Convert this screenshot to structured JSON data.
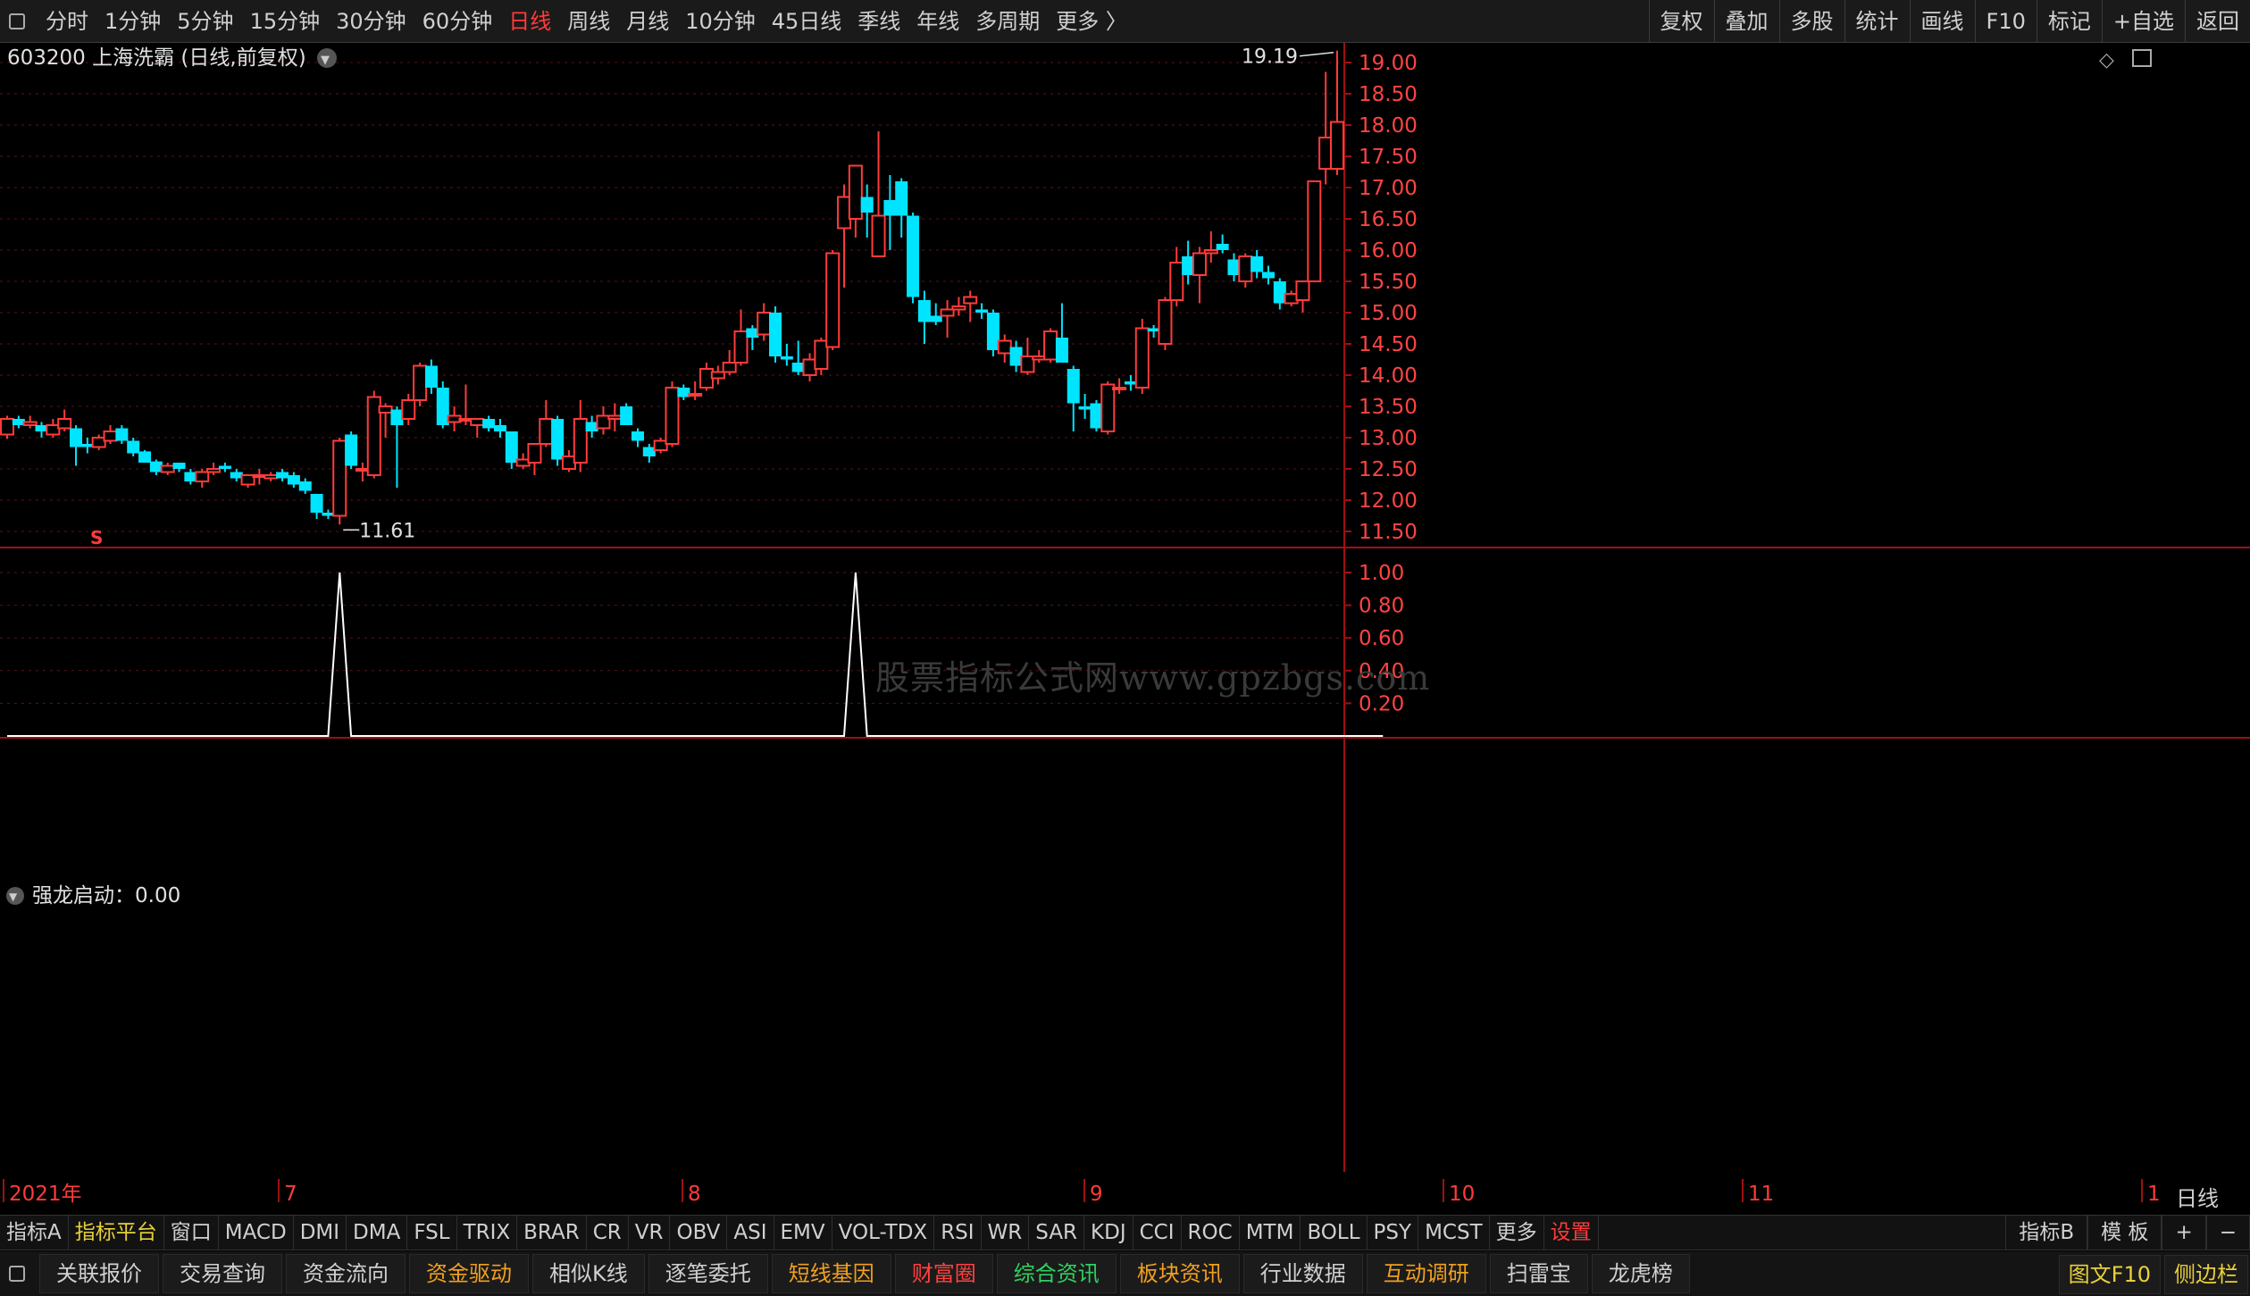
{
  "top_toolbar": {
    "left_items": [
      "分时",
      "1分钟",
      "5分钟",
      "15分钟",
      "30分钟",
      "60分钟",
      "日线",
      "周线",
      "月线",
      "10分钟",
      "45日线",
      "季线",
      "年线",
      "多周期",
      "更多 〉"
    ],
    "active": "日线",
    "right_items": [
      "复权",
      "叠加",
      "多股",
      "统计",
      "画线",
      "F10",
      "标记",
      "+自选",
      "返回"
    ]
  },
  "chart_header": {
    "code": "603200",
    "name": "上海洗霸",
    "period": "(日线,前复权)"
  },
  "watermark": "股票指标公式网www.gpzbgs.com",
  "indicator_label": "强龙启动：0.00",
  "chart_data": [
    {
      "type": "candlestick",
      "title": "603200 上海洗霸 (日线,前复权)",
      "ylim": [
        11.25,
        19.4
      ],
      "y_ticks": [
        "19.00",
        "18.50",
        "18.00",
        "17.50",
        "17.00",
        "16.50",
        "16.00",
        "15.50",
        "15.00",
        "14.50",
        "14.00",
        "13.50",
        "13.00",
        "12.50",
        "12.00",
        "11.50"
      ],
      "x_labels": [
        "2021年",
        "7",
        "8",
        "9",
        "10",
        "11",
        "1"
      ],
      "max_label": "19.19",
      "min_label": "11.61",
      "marker": "S",
      "candles": [
        {
          "o": 13.05,
          "h": 13.35,
          "l": 12.98,
          "c": 13.3
        },
        {
          "o": 13.3,
          "h": 13.35,
          "l": 13.15,
          "c": 13.2
        },
        {
          "o": 13.2,
          "h": 13.35,
          "l": 13.15,
          "c": 13.25
        },
        {
          "o": 13.2,
          "h": 13.25,
          "l": 13.0,
          "c": 13.1
        },
        {
          "o": 13.05,
          "h": 13.3,
          "l": 13.0,
          "c": 13.2
        },
        {
          "o": 13.15,
          "h": 13.45,
          "l": 13.1,
          "c": 13.3
        },
        {
          "o": 13.15,
          "h": 13.2,
          "l": 12.55,
          "c": 12.85
        },
        {
          "o": 12.9,
          "h": 13.0,
          "l": 12.75,
          "c": 12.85
        },
        {
          "o": 12.85,
          "h": 13.05,
          "l": 12.8,
          "c": 13.0
        },
        {
          "o": 12.95,
          "h": 13.2,
          "l": 12.9,
          "c": 13.1
        },
        {
          "o": 13.15,
          "h": 13.2,
          "l": 12.9,
          "c": 12.95
        },
        {
          "o": 12.95,
          "h": 13.0,
          "l": 12.7,
          "c": 12.75
        },
        {
          "o": 12.78,
          "h": 12.8,
          "l": 12.6,
          "c": 12.6
        },
        {
          "o": 12.62,
          "h": 12.65,
          "l": 12.4,
          "c": 12.45
        },
        {
          "o": 12.45,
          "h": 12.6,
          "l": 12.4,
          "c": 12.55
        },
        {
          "o": 12.6,
          "h": 12.6,
          "l": 12.45,
          "c": 12.5
        },
        {
          "o": 12.45,
          "h": 12.5,
          "l": 12.25,
          "c": 12.3
        },
        {
          "o": 12.3,
          "h": 12.5,
          "l": 12.2,
          "c": 12.45
        },
        {
          "o": 12.45,
          "h": 12.6,
          "l": 12.4,
          "c": 12.5
        },
        {
          "o": 12.55,
          "h": 12.6,
          "l": 12.45,
          "c": 12.5
        },
        {
          "o": 12.45,
          "h": 12.5,
          "l": 12.3,
          "c": 12.35
        },
        {
          "o": 12.25,
          "h": 12.4,
          "l": 12.2,
          "c": 12.4
        },
        {
          "o": 12.38,
          "h": 12.5,
          "l": 12.25,
          "c": 12.4
        },
        {
          "o": 12.35,
          "h": 12.45,
          "l": 12.3,
          "c": 12.4
        },
        {
          "o": 12.45,
          "h": 12.5,
          "l": 12.3,
          "c": 12.35
        },
        {
          "o": 12.4,
          "h": 12.45,
          "l": 12.2,
          "c": 12.25
        },
        {
          "o": 12.3,
          "h": 12.35,
          "l": 12.1,
          "c": 12.15
        },
        {
          "o": 12.1,
          "h": 12.1,
          "l": 11.7,
          "c": 11.8
        },
        {
          "o": 11.8,
          "h": 11.85,
          "l": 11.7,
          "c": 11.75
        },
        {
          "o": 11.75,
          "h": 13.0,
          "l": 11.61,
          "c": 12.95
        },
        {
          "o": 13.05,
          "h": 13.1,
          "l": 12.5,
          "c": 12.55
        },
        {
          "o": 12.5,
          "h": 12.6,
          "l": 12.3,
          "c": 12.5
        },
        {
          "o": 12.4,
          "h": 13.75,
          "l": 12.35,
          "c": 13.65
        },
        {
          "o": 13.4,
          "h": 13.55,
          "l": 13.0,
          "c": 13.5
        },
        {
          "o": 13.45,
          "h": 13.5,
          "l": 12.2,
          "c": 13.2
        },
        {
          "o": 13.3,
          "h": 13.7,
          "l": 13.2,
          "c": 13.6
        },
        {
          "o": 13.6,
          "h": 14.2,
          "l": 13.5,
          "c": 14.15
        },
        {
          "o": 14.15,
          "h": 14.25,
          "l": 13.7,
          "c": 13.8
        },
        {
          "o": 13.8,
          "h": 13.9,
          "l": 13.15,
          "c": 13.2
        },
        {
          "o": 13.25,
          "h": 13.5,
          "l": 13.1,
          "c": 13.35
        },
        {
          "o": 13.3,
          "h": 13.85,
          "l": 13.2,
          "c": 13.3
        },
        {
          "o": 13.2,
          "h": 13.3,
          "l": 13.0,
          "c": 13.3
        },
        {
          "o": 13.3,
          "h": 13.35,
          "l": 13.1,
          "c": 13.15
        },
        {
          "o": 13.2,
          "h": 13.3,
          "l": 13.0,
          "c": 13.1
        },
        {
          "o": 13.1,
          "h": 13.1,
          "l": 12.5,
          "c": 12.6
        },
        {
          "o": 12.55,
          "h": 12.75,
          "l": 12.5,
          "c": 12.65
        },
        {
          "o": 12.6,
          "h": 12.9,
          "l": 12.4,
          "c": 12.9
        },
        {
          "o": 12.9,
          "h": 13.6,
          "l": 12.85,
          "c": 13.3
        },
        {
          "o": 13.3,
          "h": 13.35,
          "l": 12.55,
          "c": 12.65
        },
        {
          "o": 12.5,
          "h": 12.8,
          "l": 12.45,
          "c": 12.7
        },
        {
          "o": 12.6,
          "h": 13.6,
          "l": 12.45,
          "c": 13.3
        },
        {
          "o": 13.25,
          "h": 13.35,
          "l": 13.0,
          "c": 13.1
        },
        {
          "o": 13.15,
          "h": 13.5,
          "l": 13.05,
          "c": 13.35
        },
        {
          "o": 13.3,
          "h": 13.55,
          "l": 13.1,
          "c": 13.35
        },
        {
          "o": 13.5,
          "h": 13.55,
          "l": 13.2,
          "c": 13.2
        },
        {
          "o": 13.1,
          "h": 13.15,
          "l": 12.85,
          "c": 12.95
        },
        {
          "o": 12.85,
          "h": 12.9,
          "l": 12.6,
          "c": 12.7
        },
        {
          "o": 12.8,
          "h": 13.0,
          "l": 12.75,
          "c": 12.95
        },
        {
          "o": 12.9,
          "h": 13.9,
          "l": 12.85,
          "c": 13.8
        },
        {
          "o": 13.8,
          "h": 13.85,
          "l": 13.6,
          "c": 13.65
        },
        {
          "o": 13.7,
          "h": 13.9,
          "l": 13.6,
          "c": 13.7
        },
        {
          "o": 13.8,
          "h": 14.2,
          "l": 13.75,
          "c": 14.1
        },
        {
          "o": 13.95,
          "h": 14.15,
          "l": 13.85,
          "c": 14.05
        },
        {
          "o": 14.05,
          "h": 14.4,
          "l": 14.0,
          "c": 14.2
        },
        {
          "o": 14.2,
          "h": 15.05,
          "l": 14.15,
          "c": 14.7
        },
        {
          "o": 14.75,
          "h": 14.8,
          "l": 14.4,
          "c": 14.6
        },
        {
          "o": 14.65,
          "h": 15.15,
          "l": 14.55,
          "c": 15.0
        },
        {
          "o": 15.0,
          "h": 15.1,
          "l": 14.2,
          "c": 14.3
        },
        {
          "o": 14.3,
          "h": 14.5,
          "l": 14.15,
          "c": 14.25
        },
        {
          "o": 14.2,
          "h": 14.55,
          "l": 14.0,
          "c": 14.05
        },
        {
          "o": 14.0,
          "h": 14.35,
          "l": 13.9,
          "c": 14.25
        },
        {
          "o": 14.1,
          "h": 14.6,
          "l": 14.0,
          "c": 14.55
        },
        {
          "o": 14.45,
          "h": 16.0,
          "l": 14.4,
          "c": 15.95
        },
        {
          "o": 16.35,
          "h": 17.05,
          "l": 15.4,
          "c": 16.85
        },
        {
          "o": 16.5,
          "h": 17.35,
          "l": 16.2,
          "c": 17.35
        },
        {
          "o": 16.85,
          "h": 17.05,
          "l": 16.2,
          "c": 16.6
        },
        {
          "o": 15.9,
          "h": 17.9,
          "l": 15.9,
          "c": 16.55
        },
        {
          "o": 16.8,
          "h": 17.2,
          "l": 16.0,
          "c": 16.55
        },
        {
          "o": 17.1,
          "h": 17.15,
          "l": 16.2,
          "c": 16.55
        },
        {
          "o": 16.55,
          "h": 16.6,
          "l": 15.15,
          "c": 15.25
        },
        {
          "o": 15.2,
          "h": 15.35,
          "l": 14.5,
          "c": 14.85
        },
        {
          "o": 14.95,
          "h": 15.15,
          "l": 14.8,
          "c": 14.85
        },
        {
          "o": 14.95,
          "h": 15.2,
          "l": 14.6,
          "c": 15.05
        },
        {
          "o": 15.05,
          "h": 15.25,
          "l": 14.95,
          "c": 15.1
        },
        {
          "o": 15.15,
          "h": 15.35,
          "l": 14.85,
          "c": 15.25
        },
        {
          "o": 15.05,
          "h": 15.15,
          "l": 14.9,
          "c": 15.0
        },
        {
          "o": 15.0,
          "h": 15.05,
          "l": 14.3,
          "c": 14.4
        },
        {
          "o": 14.35,
          "h": 14.65,
          "l": 14.2,
          "c": 14.55
        },
        {
          "o": 14.45,
          "h": 14.55,
          "l": 14.05,
          "c": 14.15
        },
        {
          "o": 14.05,
          "h": 14.6,
          "l": 14.0,
          "c": 14.3
        },
        {
          "o": 14.25,
          "h": 14.4,
          "l": 14.2,
          "c": 14.3
        },
        {
          "o": 14.25,
          "h": 14.75,
          "l": 14.2,
          "c": 14.7
        },
        {
          "o": 14.6,
          "h": 15.15,
          "l": 14.2,
          "c": 14.2
        },
        {
          "o": 14.1,
          "h": 14.15,
          "l": 13.1,
          "c": 13.55
        },
        {
          "o": 13.5,
          "h": 13.7,
          "l": 13.3,
          "c": 13.45
        },
        {
          "o": 13.55,
          "h": 13.6,
          "l": 13.1,
          "c": 13.15
        },
        {
          "o": 13.1,
          "h": 13.9,
          "l": 13.05,
          "c": 13.85
        },
        {
          "o": 13.8,
          "h": 13.95,
          "l": 13.7,
          "c": 13.8
        },
        {
          "o": 13.9,
          "h": 14.0,
          "l": 13.75,
          "c": 13.85
        },
        {
          "o": 13.8,
          "h": 14.9,
          "l": 13.7,
          "c": 14.75
        },
        {
          "o": 14.75,
          "h": 14.8,
          "l": 14.6,
          "c": 14.7
        },
        {
          "o": 14.5,
          "h": 15.25,
          "l": 14.4,
          "c": 15.2
        },
        {
          "o": 15.2,
          "h": 16.05,
          "l": 15.1,
          "c": 15.8
        },
        {
          "o": 15.9,
          "h": 16.15,
          "l": 15.45,
          "c": 15.6
        },
        {
          "o": 15.6,
          "h": 16.05,
          "l": 15.15,
          "c": 15.95
        },
        {
          "o": 15.95,
          "h": 16.3,
          "l": 15.8,
          "c": 16.0
        },
        {
          "o": 16.1,
          "h": 16.25,
          "l": 15.95,
          "c": 16.0
        },
        {
          "o": 15.85,
          "h": 15.95,
          "l": 15.5,
          "c": 15.6
        },
        {
          "o": 15.5,
          "h": 15.95,
          "l": 15.4,
          "c": 15.9
        },
        {
          "o": 15.9,
          "h": 16.0,
          "l": 15.55,
          "c": 15.65
        },
        {
          "o": 15.65,
          "h": 15.75,
          "l": 15.45,
          "c": 15.55
        },
        {
          "o": 15.5,
          "h": 15.55,
          "l": 15.05,
          "c": 15.15
        },
        {
          "o": 15.15,
          "h": 15.35,
          "l": 15.1,
          "c": 15.3
        },
        {
          "o": 15.2,
          "h": 15.5,
          "l": 15.0,
          "c": 15.5
        },
        {
          "o": 15.5,
          "h": 17.1,
          "l": 15.5,
          "c": 17.1
        },
        {
          "o": 17.3,
          "h": 18.85,
          "l": 17.05,
          "c": 17.8
        },
        {
          "o": 17.3,
          "h": 19.19,
          "l": 17.2,
          "c": 18.05
        }
      ]
    },
    {
      "type": "line",
      "title": "强龙启动：0.00",
      "ylim": [
        0,
        1.1
      ],
      "y_ticks": [
        "1.00",
        "0.80",
        "0.60",
        "0.40",
        "0.20"
      ],
      "x_labels": [
        "2021年",
        "7",
        "8",
        "9",
        "10",
        "11",
        "1"
      ],
      "series": [
        {
          "values": [
            0,
            0,
            0,
            0,
            0,
            0,
            0,
            0,
            0,
            0,
            0,
            0,
            0,
            0,
            0,
            0,
            0,
            0,
            0,
            0,
            0,
            0,
            0,
            0,
            0,
            0,
            0,
            0,
            0,
            1,
            0,
            0,
            0,
            0,
            0,
            0,
            0,
            0,
            0,
            0,
            0,
            0,
            0,
            0,
            0,
            0,
            0,
            0,
            0,
            0,
            0,
            0,
            0,
            0,
            0,
            0,
            0,
            0,
            0,
            0,
            0,
            0,
            0,
            0,
            0,
            0,
            0,
            0,
            0,
            0,
            0,
            0,
            0,
            0,
            1,
            0,
            0,
            0,
            0,
            0,
            0,
            0,
            0,
            0,
            0,
            0,
            0,
            0,
            0,
            0,
            0,
            0,
            0,
            0,
            0,
            0,
            0,
            0,
            0,
            0,
            0,
            0,
            0,
            0,
            0,
            0,
            0,
            0,
            0,
            0,
            0,
            0,
            0,
            0,
            0,
            0,
            0,
            0,
            0,
            0,
            0
          ]
        }
      ]
    }
  ],
  "colors": {
    "up": "#ff3b3b",
    "down": "#00e5ff",
    "axis": "#a01010",
    "grid": "#5a1414",
    "signal": "#ffffff"
  },
  "indicator_tabs": [
    "指标A",
    "指标平台",
    "窗口",
    "MACD",
    "DMI",
    "DMA",
    "FSL",
    "TRIX",
    "BRAR",
    "CR",
    "VR",
    "OBV",
    "ASI",
    "EMV",
    "VOL-TDX",
    "RSI",
    "WR",
    "SAR",
    "KDJ",
    "CCI",
    "ROC",
    "MTM",
    "BOLL",
    "PSY",
    "MCST",
    "更多",
    "设置"
  ],
  "indicator_tabs_right": [
    "指标B",
    "模 板",
    "+",
    "−"
  ],
  "timeframe_tag": "日线",
  "bottom_buttons": [
    {
      "label": "关联报价",
      "color": "white"
    },
    {
      "label": "交易查询",
      "color": "white"
    },
    {
      "label": "资金流向",
      "color": "white"
    },
    {
      "label": "资金驱动",
      "color": "orange"
    },
    {
      "label": "相似K线",
      "color": "white"
    },
    {
      "label": "逐笔委托",
      "color": "white"
    },
    {
      "label": "短线基因",
      "color": "orange"
    },
    {
      "label": "财富圈",
      "color": "red"
    },
    {
      "label": "综合资讯",
      "color": "green"
    },
    {
      "label": "板块资讯",
      "color": "orange"
    },
    {
      "label": "行业数据",
      "color": "white"
    },
    {
      "label": "互动调研",
      "color": "orange"
    },
    {
      "label": "扫雷宝",
      "color": "white"
    },
    {
      "label": "龙虎榜",
      "color": "white"
    }
  ],
  "bottom_right": [
    "图文F10",
    "侧边栏"
  ]
}
